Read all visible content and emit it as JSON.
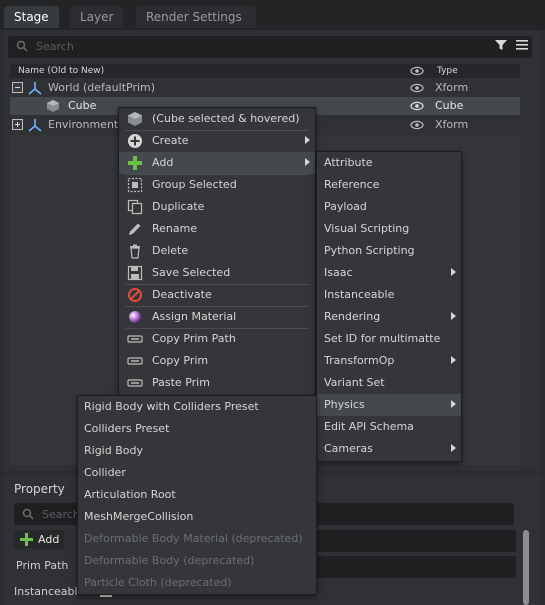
{
  "tabs": {
    "stage": "Stage",
    "layer": "Layer",
    "render_settings": "Render Settings"
  },
  "stage": {
    "search_placeholder": "Search",
    "columns": {
      "name": "Name (Old to New)",
      "type": "Type"
    },
    "tree": [
      {
        "name": "World (defaultPrim)",
        "type": "Xform"
      },
      {
        "name": "Cube",
        "type": "Cube"
      },
      {
        "name": "Environment",
        "type": "Xform"
      }
    ]
  },
  "context_menu": {
    "header": "(Cube selected & hovered)",
    "items": [
      "Create",
      "Add",
      "Group Selected",
      "Duplicate",
      "Rename",
      "Delete",
      "Save Selected",
      "Deactivate",
      "Assign Material",
      "Copy Prim Path",
      "Copy Prim",
      "Paste Prim"
    ]
  },
  "add_menu": {
    "items": [
      "Attribute",
      "Reference",
      "Payload",
      "Visual Scripting",
      "Python Scripting",
      "Isaac",
      "Instanceable",
      "Rendering",
      "Set ID for multimatte",
      "TransformOp",
      "Variant Set",
      "Physics",
      "Edit API Schema",
      "Cameras"
    ]
  },
  "physics_menu": {
    "items": [
      "Rigid Body with Colliders Preset",
      "Colliders Preset",
      "Rigid Body",
      "Collider",
      "Articulation Root",
      "MeshMergeCollision",
      "Deformable Body Material (deprecated)",
      "Deformable Body (deprecated)",
      "Particle Cloth (deprecated)"
    ]
  },
  "property": {
    "tab": "Property",
    "search_placeholder": "Search",
    "add_label": "Add",
    "prim_path_label": "Prim Path",
    "instanceable_label": "Instanceable"
  },
  "colors": {
    "accent_blue": "#4a90d9",
    "add_green": "#6cc04a",
    "deactivate_red": "#e04b3a"
  }
}
